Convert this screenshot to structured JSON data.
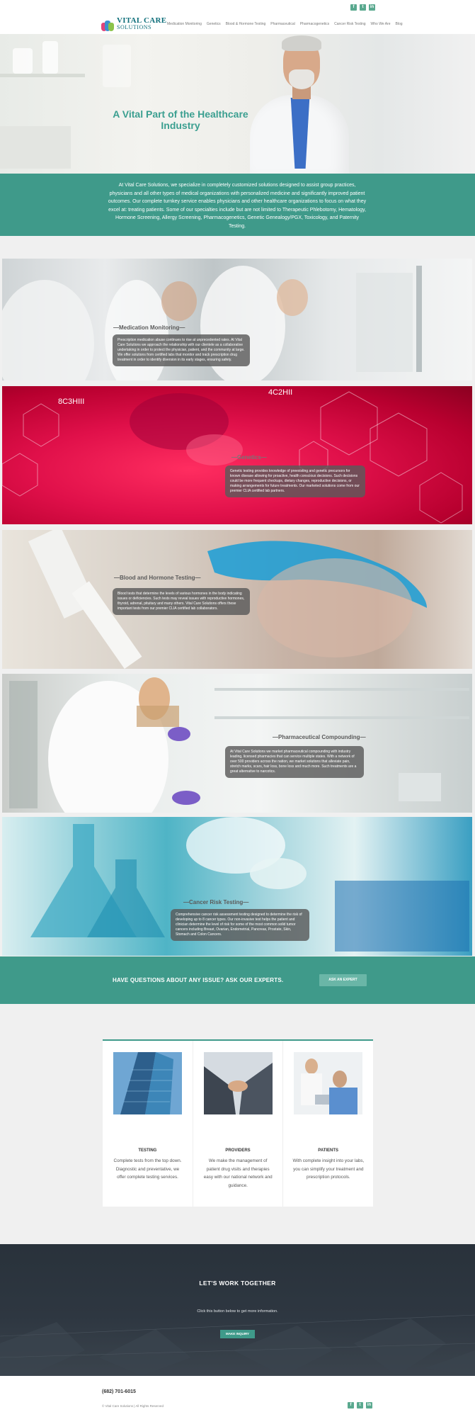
{
  "header": {
    "logo_line1": "VITAL CARE",
    "logo_line2": "SOLUTIONS",
    "nav": [
      "Medication Monitoring",
      "Genetics",
      "Blood & Hormone Testing",
      "Pharmaceutical",
      "Pharmacogenetics",
      "Cancer Risk Testing",
      "Who We Are",
      "Blog"
    ],
    "social": [
      "f",
      "t",
      "in"
    ]
  },
  "hero": {
    "title": "A Vital Part of the Healthcare Industry"
  },
  "intro": {
    "text": "At Vital Care Solutions, we specialize in completely customized solutions designed to assist group practices, physicians and all other types of medical organizations with personalized medicine and significantly improved patient outcomes. Our complete turnkey service enables physicians and other healthcare organizations to focus on what they excel at: treating patients. Some of our specialties include but are not limited to Therapeutic Phlebotomy, Hematology, Hormone Screening, Allergy Screening, Pharmacogenetics, Genetic Genealogy/PGX, Toxicology, and Paternity Testing."
  },
  "services": [
    {
      "title": "—Medication Monitoring—",
      "text": "Prescription medication abuse continues to rise at unprecedented rates. At Vital Care Solutions we approach the relationship with our clientele as a collaborative undertaking in order to protect the physician, patient, and the community at large. We offer solutions from certified labs that monitor and track prescription drug treatment in order to identify diversion in its early stages, ensuring safety."
    },
    {
      "title": "—Genetics—",
      "text": "Genetic testing provides knowledge of preexisting and genetic precursors for known disease allowing for proactive, health conscious decisions. Such decisions could be more frequent checkups, dietary changes, reproductive decisions, or making arrangements for future treatments. Our marketed solutions come from our premier CLIA certified lab partners.",
      "overlay_left": "8C3HIII",
      "overlay_right": "4C2HII"
    },
    {
      "title": "—Blood and Hormone Testing—",
      "text": "Blood tests that determine the levels of various hormones in the body indicating issues or deficiencies. Such tests may reveal issues with reproductive hormones, thyroid, adrenal, pituitary and many others. Vital Care Solutions offers these important tests from our premier CLIA certified lab collaborators."
    },
    {
      "title": "—Pharmaceutical Compounding—",
      "text": "At Vital Care Solutions we market pharmaceutical compounding with industry leading, licensed pharmacies that can service multiple states. With a network of over 500 providers across the nation, we market solutions that alleviate pain, stretch marks, scars, hair loss, bone loss and much more. Such treatments are a great alternative to narcotics."
    },
    {
      "title": "—Cancer Risk Testing—",
      "text": "Comprehensive cancer risk assessment testing designed to determine the risk of developing up to 8 cancer types. Our non-invasive test helps the patient and clinician determine the level of risk for some of the most common solid tumor cancers including Breast, Ovarian, Endometrial, Pancreas, Prostate, Skin, Stomach and Colon Cancers."
    }
  ],
  "cta": {
    "question": "HAVE QUESTIONS ABOUT ANY ISSUE? ASK OUR EXPERTS.",
    "button": "ASK AN EXPERT"
  },
  "cards": [
    {
      "title": "TESTING",
      "text": "Complete tests from the top down. Diagnostic and preventative, we offer complete testing services."
    },
    {
      "title": "PROVIDERS",
      "text": "We make the management of patient drug visits and therapies easy with our national network and guidance."
    },
    {
      "title": "PATIENTS",
      "text": "With complete insight into your labs, you can simplify your treatment and prescription protocols."
    }
  ],
  "work": {
    "heading": "LET'S WORK TOGETHER",
    "sub": "Click this button below to get more information.",
    "button": "MAKE INQUIRY"
  },
  "footer": {
    "phone": "(682) 701-6015",
    "copyright": "© Vital Care Solutions  |  All Rights Reserved"
  },
  "colors": {
    "teal": "#3f9a8a",
    "teal_light": "#6ab6a7",
    "dark": "#2e3741",
    "logo_blue": "#0e6e7a"
  }
}
